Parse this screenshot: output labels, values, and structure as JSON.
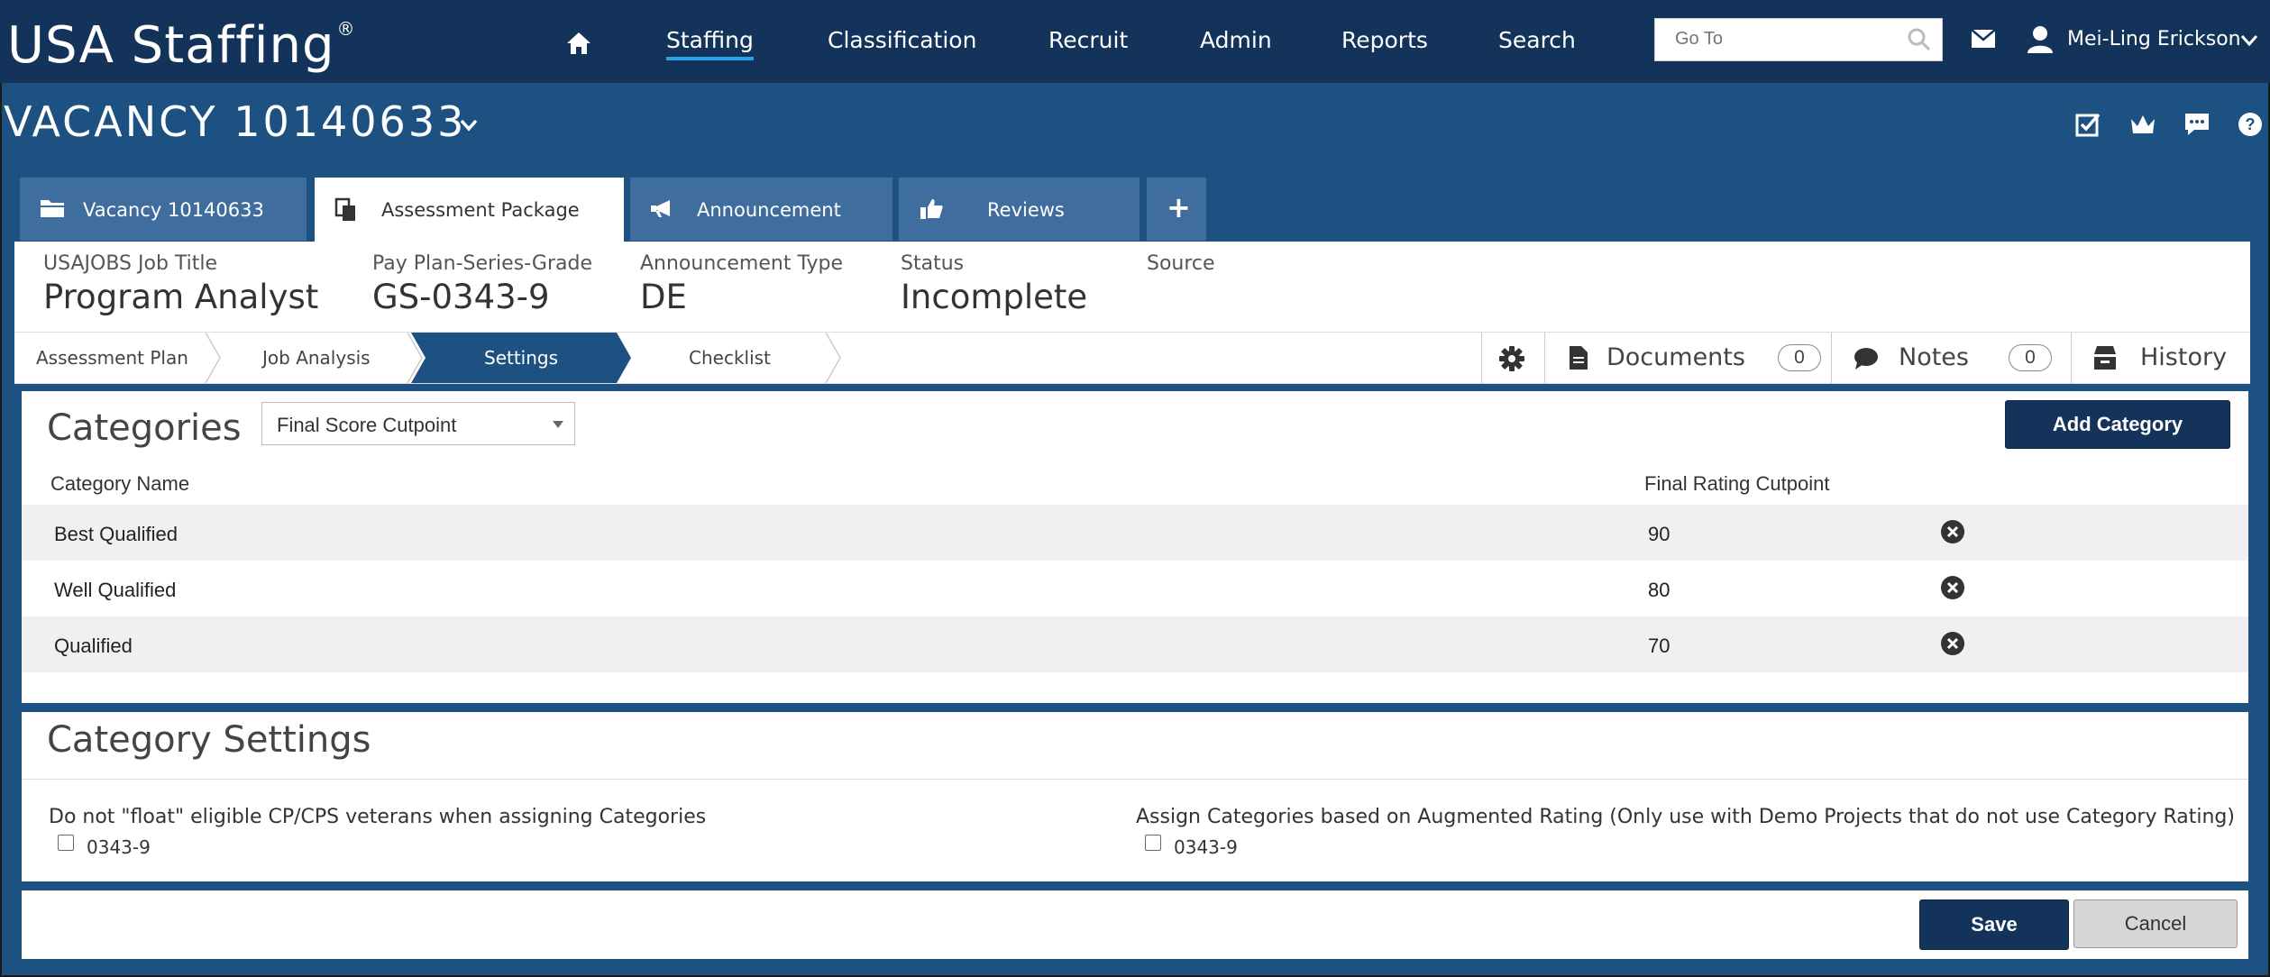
{
  "brand": {
    "name": "USA Staffing",
    "mark": "®"
  },
  "nav": {
    "items": [
      {
        "label": "Staffing",
        "active": true
      },
      {
        "label": "Classification"
      },
      {
        "label": "Recruit"
      },
      {
        "label": "Admin"
      },
      {
        "label": "Reports"
      },
      {
        "label": "Search"
      }
    ],
    "goto_placeholder": "Go To",
    "user_name": "Mei-Ling Erickson"
  },
  "vacancy": {
    "title": "VACANCY 10140633"
  },
  "tabs": [
    {
      "label": "Vacancy 10140633",
      "icon": "folder-icon"
    },
    {
      "label": "Assessment Package",
      "icon": "copy-icon",
      "active": true
    },
    {
      "label": "Announcement",
      "icon": "megaphone-icon"
    },
    {
      "label": "Reviews",
      "icon": "thumbs-up-icon"
    },
    {
      "label": "+",
      "icon": "add-icon"
    }
  ],
  "info": [
    {
      "label": "USAJOBS Job Title",
      "value": "Program Analyst"
    },
    {
      "label": "Pay Plan-Series-Grade",
      "value": "GS-0343-9"
    },
    {
      "label": "Announcement Type",
      "value": "DE"
    },
    {
      "label": "Status",
      "value": "Incomplete"
    },
    {
      "label": "Source",
      "value": ""
    }
  ],
  "steps": [
    {
      "label": "Assessment Plan"
    },
    {
      "label": "Job Analysis"
    },
    {
      "label": "Settings",
      "active": true
    },
    {
      "label": "Checklist"
    }
  ],
  "tools": {
    "documents_label": "Documents",
    "documents_count": "0",
    "notes_label": "Notes",
    "notes_count": "0",
    "history_label": "History"
  },
  "categories": {
    "title": "Categories",
    "select_value": "Final Score Cutpoint",
    "add_label": "Add Category",
    "col_name": "Category Name",
    "col_cutpoint": "Final Rating Cutpoint",
    "rows": [
      {
        "name": "Best Qualified",
        "cutpoint": "90"
      },
      {
        "name": "Well Qualified",
        "cutpoint": "80"
      },
      {
        "name": "Qualified",
        "cutpoint": "70"
      }
    ]
  },
  "settings": {
    "title": "Category Settings",
    "option1_label": "Do not \"float\" eligible CP/CPS veterans when assigning Categories",
    "option1_item": "0343-9",
    "option2_label": "Assign Categories based on Augmented Rating (Only use with Demo Projects that do not use Category Rating)",
    "option2_item": "0343-9"
  },
  "footer": {
    "save_label": "Save",
    "cancel_label": "Cancel"
  },
  "colors": {
    "navy": "#14335a",
    "blue": "#1d5182",
    "tab": "#3f6e9e",
    "accent": "#2aa3e8"
  }
}
